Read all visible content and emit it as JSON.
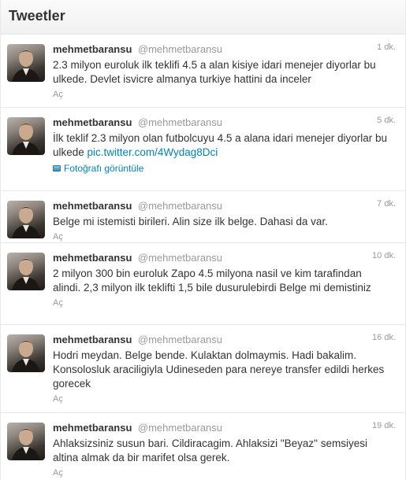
{
  "header": {
    "title": "Tweetler"
  },
  "tweets": [
    {
      "fullname": "mehmetbaransu",
      "username": "@mehmetbaransu",
      "time": "1 dk.",
      "text": "2.3 milyon euroluk ilk teklifi 4.5 a alan kisiye idari menejer diyorlar bu ulkede. Devlet isvicre almanya turkiye hattini da inceler",
      "action": "Aç"
    },
    {
      "fullname": "mehmetbaransu",
      "username": "@mehmetbaransu",
      "time": "5 dk.",
      "text": "İlk teklif 2.3 milyon olan futbolcuyu 4.5 a alana idari menejer diyorlar bu ulkede ",
      "link": "pic.twitter.com/4Wydag8Dci",
      "media_label": "Fotoğrafı görüntüle"
    },
    {
      "fullname": "mehmetbaransu",
      "username": "@mehmetbaransu",
      "time": "7 dk.",
      "text": "Belge mi istemisti birileri. Alin size ilk belge. Dahasi da var.",
      "action": "Aç"
    },
    {
      "fullname": "mehmetbaransu",
      "username": "@mehmetbaransu",
      "time": "10 dk.",
      "text": "2 milyon 300 bin euroluk Zapo 4.5 milyona nasil ve kim tarafindan alindi. 2,3 milyon ilk teklifti 1,5 bile dusurulebirdi Belge mi demistiniz",
      "action": "Aç"
    },
    {
      "fullname": "mehmetbaransu",
      "username": "@mehmetbaransu",
      "time": "16 dk.",
      "text": "Hodri meydan. Belge bende. Kulaktan dolmaymis. Hadi bakalim. Konsolosluk araciligiyla Udineseden para nereye transfer edildi herkes gorecek",
      "action": "Aç"
    },
    {
      "fullname": "mehmetbaransu",
      "username": "@mehmetbaransu",
      "time": "19 dk.",
      "text": "Ahlaksizsiniz susun bari. Cildiracagim. Ahlaksizi \"Beyaz\" semsiyesi altina almak da bir marifet olsa gerek.",
      "action": "Aç"
    }
  ]
}
